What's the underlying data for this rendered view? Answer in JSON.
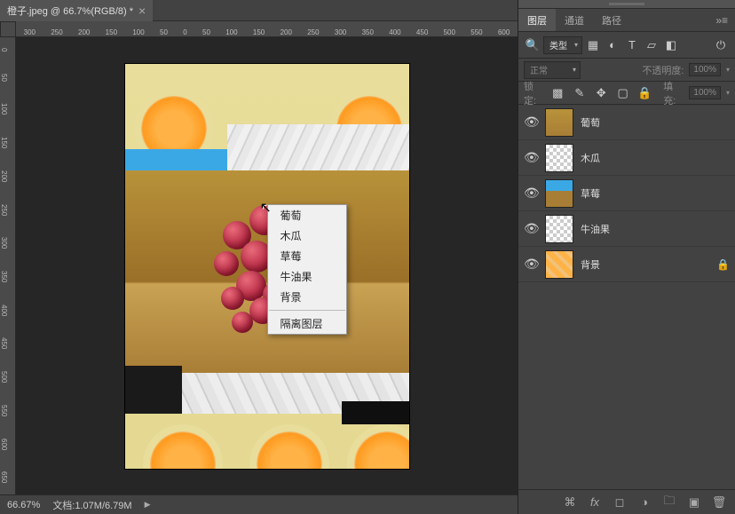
{
  "doc_title": "橙子.jpeg @ 66.7%(RGB/8) *",
  "ruler_h": [
    300,
    250,
    200,
    150,
    100,
    50,
    0,
    50,
    100,
    150,
    200,
    250,
    300,
    350,
    400,
    450,
    500,
    550,
    600
  ],
  "ruler_v": [
    0,
    50,
    100,
    150,
    200,
    250,
    300,
    350,
    400,
    450,
    500,
    550,
    600,
    650
  ],
  "context_menu": {
    "items": [
      "葡萄",
      "木瓜",
      "草莓",
      "牛油果",
      "背景"
    ],
    "isolate": "隔离图层"
  },
  "panel": {
    "tabs": [
      "图层",
      "通道",
      "路径"
    ],
    "filter_label": "类型",
    "blend_mode": "正常",
    "opacity_lbl": "不透明度:",
    "opacity_val": "100%",
    "lock_lbl": "锁定:",
    "fill_lbl": "填充:",
    "fill_val": "100%"
  },
  "layers": [
    {
      "name": "葡萄",
      "locked": false
    },
    {
      "name": "木瓜",
      "locked": false
    },
    {
      "name": "草莓",
      "locked": false
    },
    {
      "name": "牛油果",
      "locked": false
    },
    {
      "name": "背景",
      "locked": true
    }
  ],
  "status": {
    "zoom": "66.67%",
    "doc_label": "文档:",
    "doc_size": "1.07M/6.79M"
  }
}
